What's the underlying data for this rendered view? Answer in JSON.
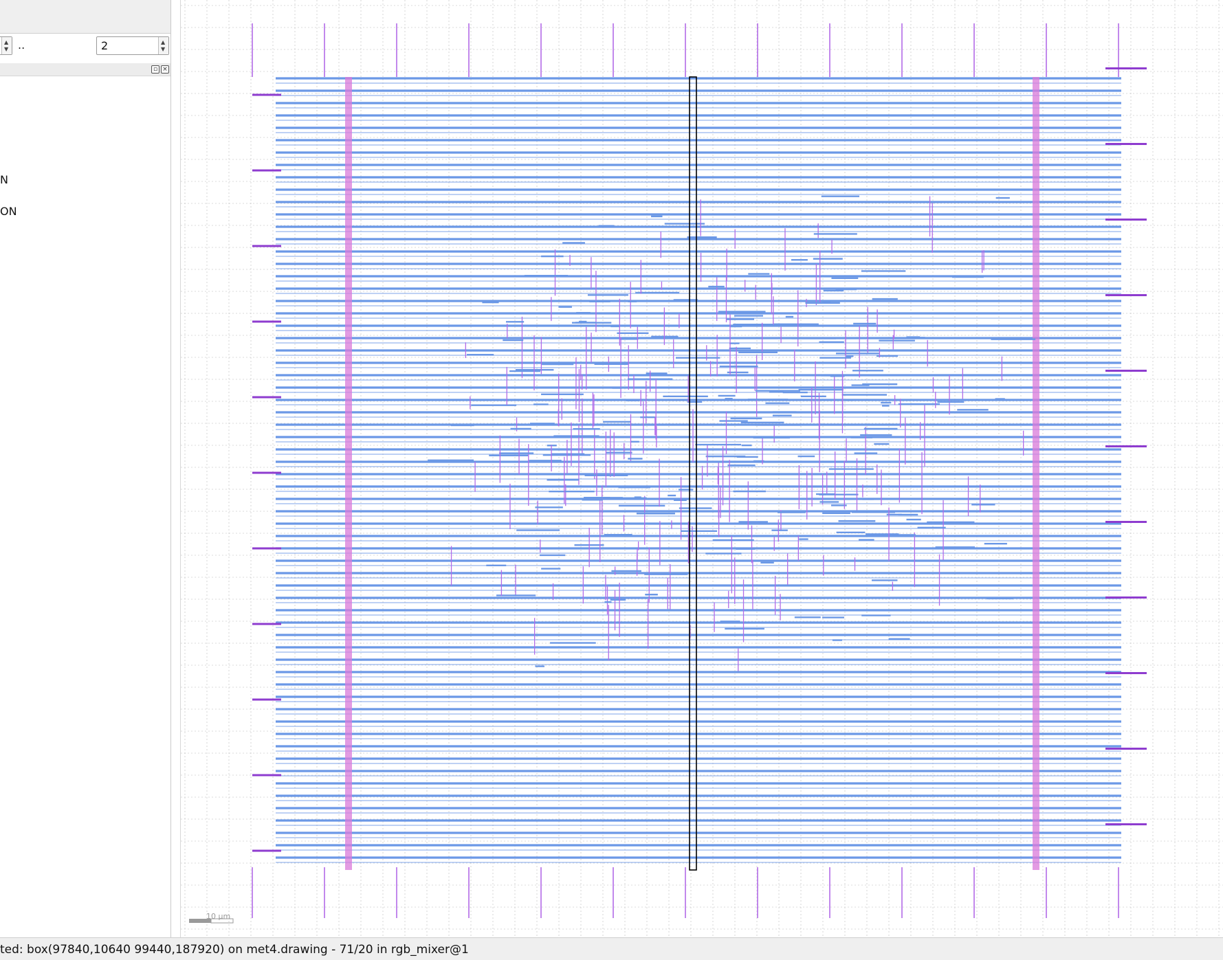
{
  "sidebar": {
    "range_separator": "..",
    "range_end_value": "2",
    "panel_float_glyph": "▫",
    "panel_close_glyph": "×",
    "list_items": [
      {
        "label": "N"
      },
      {
        "label": "ON"
      }
    ]
  },
  "layout_view": {
    "scale_label": "10 µm",
    "colors": {
      "metal_horizontal": "#6b98e6",
      "metal_vertical": "#b26be8",
      "power_stripe": "#d97ad9",
      "pin": "#8e3ccf",
      "grid": "#b8b8b8",
      "selection": "#000000"
    }
  },
  "status": {
    "message": "ted: box(97840,10640 99440,187920) on met4.drawing - 71/20 in rgb_mixer@1"
  }
}
